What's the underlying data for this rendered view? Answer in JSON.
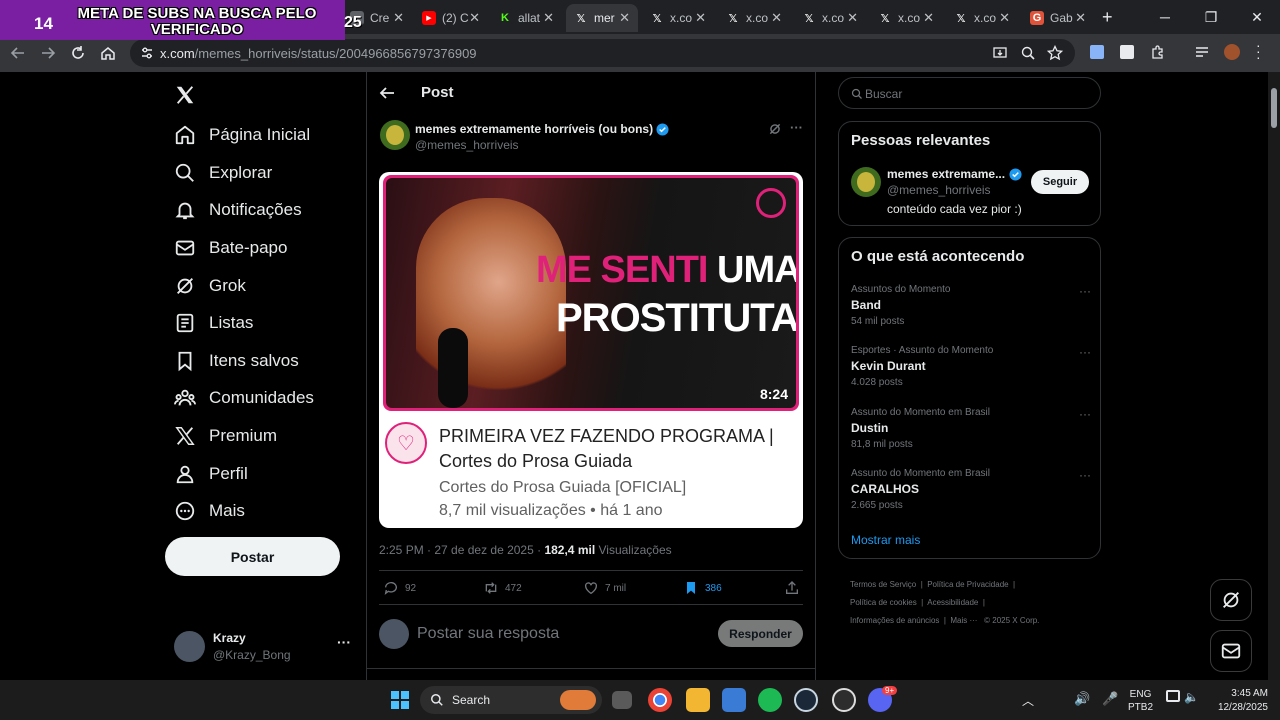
{
  "overlay": {
    "count": "14",
    "title": "META DE SUBS NA BUSCA PELO VERIFICADO",
    "count2": "25"
  },
  "tabs": [
    {
      "label": "Cre",
      "fav": "page-icon"
    },
    {
      "label": "(2) C",
      "fav": "youtube-icon"
    },
    {
      "label": "allat",
      "fav": "kick-icon"
    },
    {
      "label": "mer",
      "fav": "x-icon",
      "active": true
    },
    {
      "label": "x.co",
      "fav": "x-icon"
    },
    {
      "label": "x.co",
      "fav": "x-icon"
    },
    {
      "label": "x.co",
      "fav": "x-icon"
    },
    {
      "label": "x.co",
      "fav": "x-icon"
    },
    {
      "label": "x.co",
      "fav": "x-icon"
    },
    {
      "label": "Gab",
      "fav": "gab-icon"
    }
  ],
  "browser": {
    "url_host": "x.com",
    "url_path": "/memes_horriveis/status/2004966856797376909"
  },
  "nav": [
    {
      "label": "Página Inicial",
      "icon": "home-icon"
    },
    {
      "label": "Explorar",
      "icon": "search-icon"
    },
    {
      "label": "Notificações",
      "icon": "bell-icon"
    },
    {
      "label": "Bate-papo",
      "icon": "mail-icon"
    },
    {
      "label": "Grok",
      "icon": "grok-icon"
    },
    {
      "label": "Listas",
      "icon": "list-icon"
    },
    {
      "label": "Itens salvos",
      "icon": "bookmark-icon"
    },
    {
      "label": "Comunidades",
      "icon": "communities-icon"
    },
    {
      "label": "Premium",
      "icon": "x-icon"
    },
    {
      "label": "Perfil",
      "icon": "person-icon"
    },
    {
      "label": "Mais",
      "icon": "more-circle-icon"
    }
  ],
  "post_button": "Postar",
  "account": {
    "name": "Krazy",
    "handle": "@Krazy_Bong"
  },
  "post": {
    "header": "Post",
    "author_name": "memes extremamente horríveis (ou bons)",
    "author_handle": "@memes_horriveis",
    "thumb_text_pink": "ME SENTI",
    "thumb_text_white1": "UMA",
    "thumb_text_white2": "PROSTITUTA",
    "duration": "8:24",
    "video_title": "PRIMEIRA VEZ FAZENDO PROGRAMA | Cortes do Prosa Guiada",
    "channel": "Cortes do Prosa Guiada [OFICIAL]",
    "meta": "8,7 mil visualizações • há 1 ano",
    "timestamp": "2:25 PM · 27 de dez de 2025 · ",
    "views_count": "182,4 mil",
    "views_label": " Visualizações",
    "replies": "92",
    "reposts": "472",
    "likes": "7 mil",
    "bookmarks": "386",
    "reply_placeholder": "Postar sua resposta",
    "reply_button": "Responder"
  },
  "search": {
    "placeholder": "Buscar"
  },
  "relevant": {
    "title": "Pessoas relevantes",
    "name": "memes extremame...",
    "handle": "@memes_horriveis",
    "bio": "conteúdo cada vez pior :)",
    "follow": "Seguir"
  },
  "trends": {
    "title": "O que está acontecendo",
    "items": [
      {
        "category": "Assuntos do Momento",
        "name": "Band",
        "count": "54 mil posts"
      },
      {
        "category": "Esportes · Assunto do Momento",
        "name": "Kevin Durant",
        "count": "4.028 posts"
      },
      {
        "category": "Assunto do Momento em Brasil",
        "name": "Dustin",
        "count": "81,8 mil posts"
      },
      {
        "category": "Assunto do Momento em Brasil",
        "name": "CARALHOS",
        "count": "2.665 posts"
      }
    ],
    "show_more": "Mostrar mais"
  },
  "footer": {
    "l1a": "Termos de Serviço",
    "l1b": "Política de Privacidade",
    "l2a": "Política de cookies",
    "l2b": "Acessibilidade",
    "l3a": "Informações de anúncios",
    "l3b": "Mais ···",
    "l3c": "© 2025 X Corp."
  },
  "taskbar": {
    "search": "Search",
    "lang1": "ENG",
    "lang2": "PTB2",
    "time": "3:45 AM",
    "date": "12/28/2025",
    "discord_badge": "9+"
  },
  "colors": {
    "accent": "#1d9bf0",
    "overlay": "#7b1fa2",
    "pink": "#e0217a"
  }
}
